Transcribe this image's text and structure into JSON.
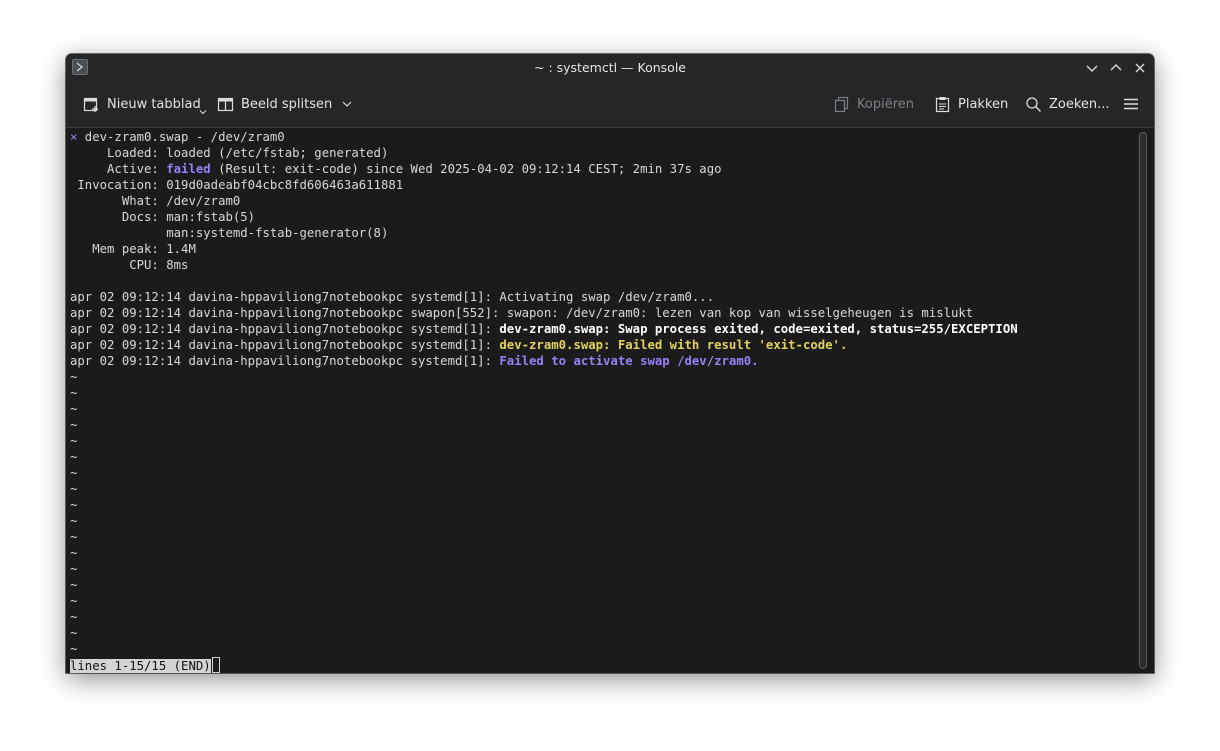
{
  "window": {
    "title": "~ : systemctl — Konsole",
    "app_icon": "konsole-icon"
  },
  "toolbar": {
    "new_tab": "Nieuw tabblad",
    "split_view": "Beeld splitsen",
    "copy": "Kopiëren",
    "paste": "Plakken",
    "find": "Zoeken..."
  },
  "terminal": {
    "line1_mark": "×",
    "line1_text": " dev-zram0.swap - /dev/zram0",
    "line2": "     Loaded: loaded (/etc/fstab; generated)",
    "line3_pre": "     Active: ",
    "line3_failed": "failed",
    "line3_post": " (Result: exit-code) since Wed 2025-04-02 09:12:14 CEST; 2min 37s ago",
    "line4": " Invocation: 019d0adeabf04cbc8fd606463a611881",
    "line5": "       What: /dev/zram0",
    "line6": "       Docs: man:fstab(5)",
    "line7": "             man:systemd-fstab-generator(8)",
    "line8": "   Mem peak: 1.4M",
    "line9": "        CPU: 8ms",
    "log1": "apr 02 09:12:14 davina-hppaviliong7notebookpc systemd[1]: Activating swap /dev/zram0...",
    "log2": "apr 02 09:12:14 davina-hppaviliong7notebookpc swapon[552]: swapon: /dev/zram0: lezen van kop van wisselgeheugen is mislukt",
    "log3_prefix": "apr 02 09:12:14 davina-hppaviliong7notebookpc systemd[1]: ",
    "log3_msg": "dev-zram0.swap: Swap process exited, code=exited, status=255/EXCEPTION",
    "log4_prefix": "apr 02 09:12:14 davina-hppaviliong7notebookpc systemd[1]: ",
    "log4_msg": "dev-zram0.swap: Failed with result 'exit-code'.",
    "log5_prefix": "apr 02 09:12:14 davina-hppaviliong7notebookpc systemd[1]: ",
    "log5_msg": "Failed to activate swap /dev/zram0.",
    "tilde": "~",
    "status_line": "lines 1-15/15 (END)"
  },
  "colors": {
    "background": "#1b1b1b",
    "chrome": "#242628",
    "failed": "#9b7ff6",
    "warning": "#e2d160"
  }
}
